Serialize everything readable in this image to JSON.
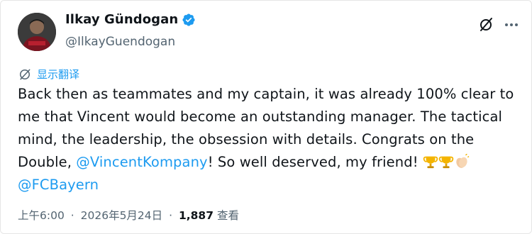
{
  "author": {
    "display_name": "Ilkay Gündogan",
    "handle": "@IlkayGuendogan",
    "verified": true
  },
  "translate_label": "显示翻译",
  "tweet": {
    "text_1": "Back then as teammates and my captain, it was already 100% clear to me that Vincent would become an outstanding manager. The tactical mind, the leadership, the obsession with details. Congrats on the Double, ",
    "mention_1": "@VincentKompany",
    "text_2": "! So well deserved, my friend! ",
    "mention_2": "@FCBayern",
    "emojis": [
      "trophy-icon",
      "trophy-icon",
      "clapping-hands-icon"
    ]
  },
  "meta": {
    "time": "上午6:00",
    "date": "2026年5月24日",
    "views_count": "1,887",
    "views_label": "查看",
    "separator": "·"
  },
  "colors": {
    "link": "#1d9bf0",
    "secondary": "#536471",
    "text": "#0f1419",
    "verified": "#1d9bf0"
  }
}
